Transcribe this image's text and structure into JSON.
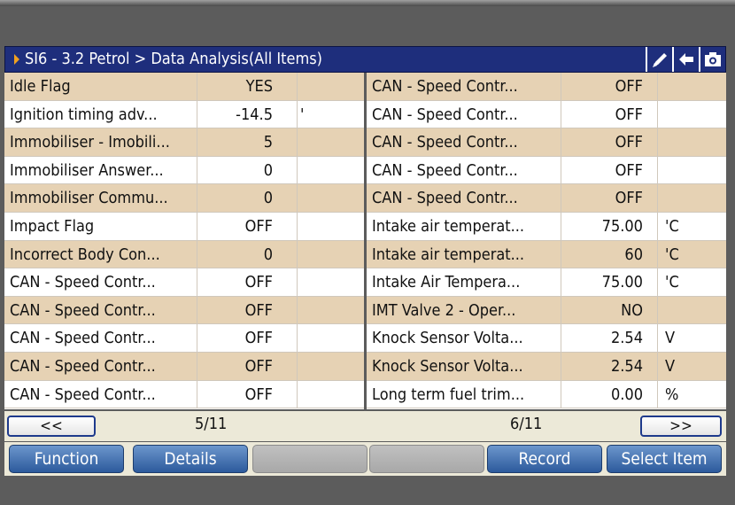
{
  "header": {
    "title": "SI6 - 3.2 Petrol > Data Analysis(All Items)",
    "icons": [
      "pen-icon",
      "back-arrow-icon",
      "camera-icon"
    ]
  },
  "left_rows": [
    {
      "name": "Idle Flag",
      "value": "YES",
      "unit": ""
    },
    {
      "name": "Ignition timing adv...",
      "value": "-14.5",
      "unit": "'"
    },
    {
      "name": "Immobiliser - Imobili...",
      "value": "5",
      "unit": ""
    },
    {
      "name": "Immobiliser Answer...",
      "value": "0",
      "unit": ""
    },
    {
      "name": "Immobiliser Commu...",
      "value": "0",
      "unit": ""
    },
    {
      "name": "Impact Flag",
      "value": "OFF",
      "unit": ""
    },
    {
      "name": "Incorrect Body Con...",
      "value": "0",
      "unit": ""
    },
    {
      "name": "CAN - Speed Contr...",
      "value": "OFF",
      "unit": ""
    },
    {
      "name": "CAN - Speed Contr...",
      "value": "OFF",
      "unit": ""
    },
    {
      "name": "CAN - Speed Contr...",
      "value": "OFF",
      "unit": ""
    },
    {
      "name": "CAN - Speed Contr...",
      "value": "OFF",
      "unit": ""
    },
    {
      "name": "CAN - Speed Contr...",
      "value": "OFF",
      "unit": ""
    }
  ],
  "right_rows": [
    {
      "name": "CAN - Speed Contr...",
      "value": "OFF",
      "unit": ""
    },
    {
      "name": "CAN - Speed Contr...",
      "value": "OFF",
      "unit": ""
    },
    {
      "name": "CAN - Speed Contr...",
      "value": "OFF",
      "unit": ""
    },
    {
      "name": "CAN - Speed Contr...",
      "value": "OFF",
      "unit": ""
    },
    {
      "name": "CAN - Speed Contr...",
      "value": "OFF",
      "unit": ""
    },
    {
      "name": "Intake air temperat...",
      "value": "75.00",
      "unit": "'C"
    },
    {
      "name": "Intake air temperat...",
      "value": "60",
      "unit": "'C"
    },
    {
      "name": "Intake Air Tempera...",
      "value": "75.00",
      "unit": "'C"
    },
    {
      "name": "IMT Valve 2 - Oper...",
      "value": "NO",
      "unit": ""
    },
    {
      "name": "Knock Sensor Volta...",
      "value": "2.54",
      "unit": "V"
    },
    {
      "name": "Knock Sensor Volta...",
      "value": "2.54",
      "unit": "V"
    },
    {
      "name": "Long term fuel trim...",
      "value": "0.00",
      "unit": "%"
    }
  ],
  "pagination": {
    "prev_label": "<<",
    "next_label": ">>",
    "left_page": "5/11",
    "right_page": "6/11"
  },
  "buttons": {
    "function": "Function",
    "details": "Details",
    "blank1": "",
    "blank2": "",
    "record": "Record",
    "select_item": "Select Item"
  },
  "colors": {
    "title_bar": "#1e2e7c",
    "row_shaded": "#e6d2b4",
    "row_plain": "#ffffff",
    "button_blue": "#3c6aac"
  }
}
